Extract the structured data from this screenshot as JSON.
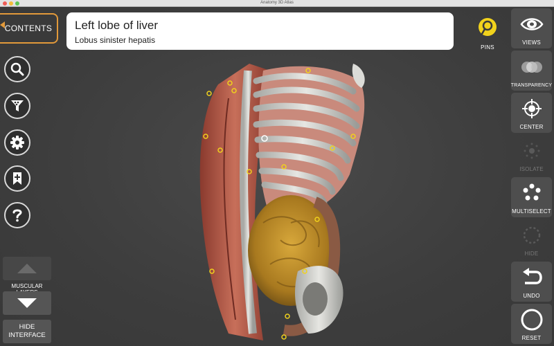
{
  "window": {
    "title": "Anatomy 3D Atlas"
  },
  "contents": {
    "label": "CONTENTS"
  },
  "selection": {
    "name": "Left lobe of liver",
    "latin_name": "Lobus sinister hepatis"
  },
  "left_tools": [
    {
      "name": "search-icon"
    },
    {
      "name": "filter-icon"
    },
    {
      "name": "gear-icon"
    },
    {
      "name": "bookmark-add-icon"
    },
    {
      "name": "help-icon"
    }
  ],
  "pins": {
    "label": "PINS",
    "color": "#f1d21c"
  },
  "right_tools": {
    "views": "VIEWS",
    "transparency": "TRANSPARENCY",
    "center": "CENTER",
    "isolate": "ISOLATE",
    "multiselect": "MULTISELECT",
    "hide": "HIDE",
    "undo": "UNDO",
    "reset": "RESET"
  },
  "layers": {
    "label": "MUSCULAR LAYERS"
  },
  "hide_interface": {
    "line1": "HIDE",
    "line2": "INTERFACE"
  },
  "colors": {
    "accent": "#e39a3a",
    "pin": "#f1d21c"
  }
}
